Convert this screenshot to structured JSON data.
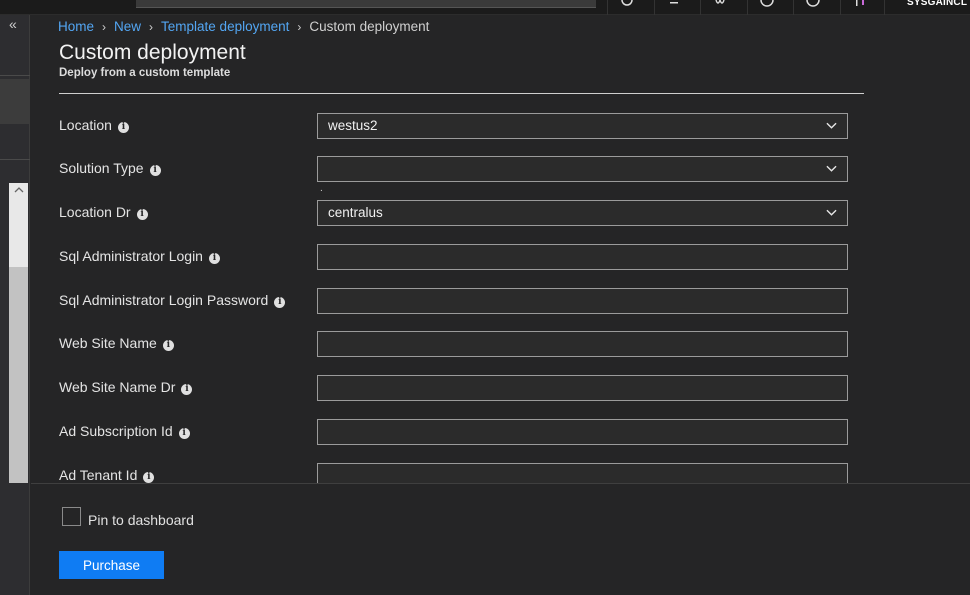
{
  "topbar": {
    "account_name": "SYSGAINCL",
    "icons": [
      "feedback-icon",
      "notifications-icon",
      "settings-icon",
      "smiley-icon",
      "help-icon",
      "person-icon"
    ]
  },
  "breadcrumb": {
    "items": [
      "Home",
      "New",
      "Template deployment"
    ],
    "current": "Custom deployment"
  },
  "page": {
    "title": "Custom deployment",
    "subtitle": "Deploy from a custom template"
  },
  "form": {
    "location": {
      "label": "Location",
      "value": "westus2"
    },
    "solution_type": {
      "label": "Solution Type",
      "value": "",
      "note": "."
    },
    "location_dr": {
      "label": "Location Dr",
      "value": "centralus"
    },
    "sql_admin_login": {
      "label": "Sql Administrator Login",
      "value": ""
    },
    "sql_admin_password": {
      "label": "Sql Administrator Login Password",
      "value": ""
    },
    "web_site_name": {
      "label": "Web Site Name",
      "value": ""
    },
    "web_site_name_dr": {
      "label": "Web Site Name Dr",
      "value": ""
    },
    "ad_subscription_id": {
      "label": "Ad Subscription Id",
      "value": ""
    },
    "ad_tenant_id": {
      "label": "Ad Tenant Id",
      "value": ""
    }
  },
  "footer": {
    "pin_label": "Pin to dashboard",
    "pin_checked": false,
    "purchase_label": "Purchase"
  },
  "colors": {
    "accent": "#0f7cf3",
    "link": "#53a6f3",
    "background": "#252526"
  }
}
